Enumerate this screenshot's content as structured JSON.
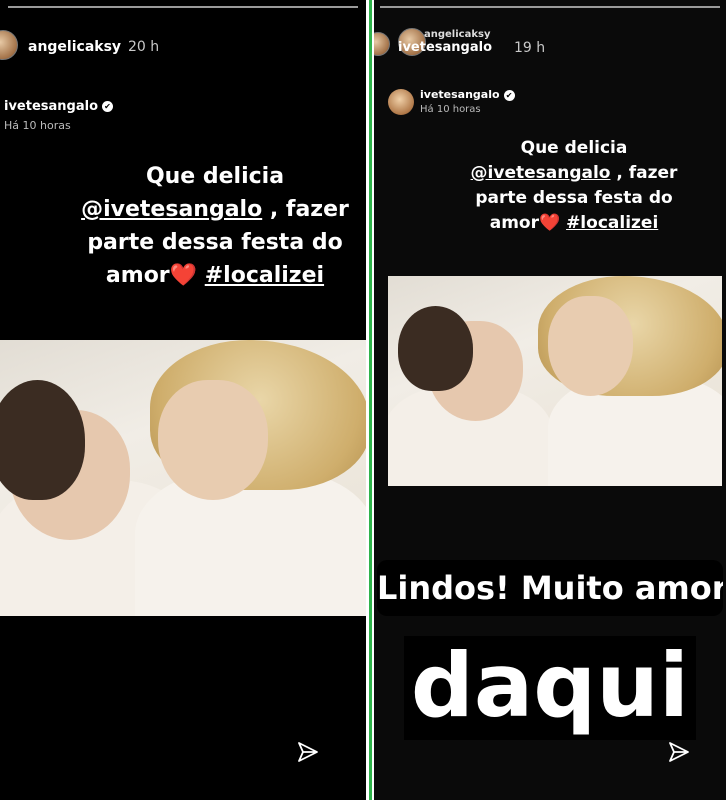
{
  "left_story": {
    "username": "angelicaksy",
    "time": "20 h",
    "shared": {
      "username": "ivetesangalo",
      "time": "Há 10 horas"
    },
    "caption": {
      "line1": "Que delicia",
      "tag": "@ivetesangalo",
      "line2_rest": " , fazer",
      "line3": "parte dessa festa do",
      "line4_start": "amor",
      "heart": "❤️",
      "hashtag": "#localizei"
    }
  },
  "right_story": {
    "username": "angelicaksy",
    "overlay_username": "ivetesangalo",
    "time": "19 h",
    "shared": {
      "username": "ivetesangalo",
      "time": "Há 10 horas"
    },
    "caption": {
      "line1": "Que delicia",
      "tag": "@ivetesangalo",
      "line2_rest": " , fazer",
      "line3": "parte dessa festa do",
      "line4_start": "amor",
      "heart": "❤️",
      "hashtag": "#localizei"
    },
    "sticker_text_1": "Lindos! Muito amor",
    "sticker_text_2": "daqui"
  },
  "icons": {
    "send": "send-paper-plane-icon",
    "verified": "verified-badge-icon"
  },
  "colors": {
    "divider": "#2eb34a",
    "heart": "#e0182a"
  }
}
